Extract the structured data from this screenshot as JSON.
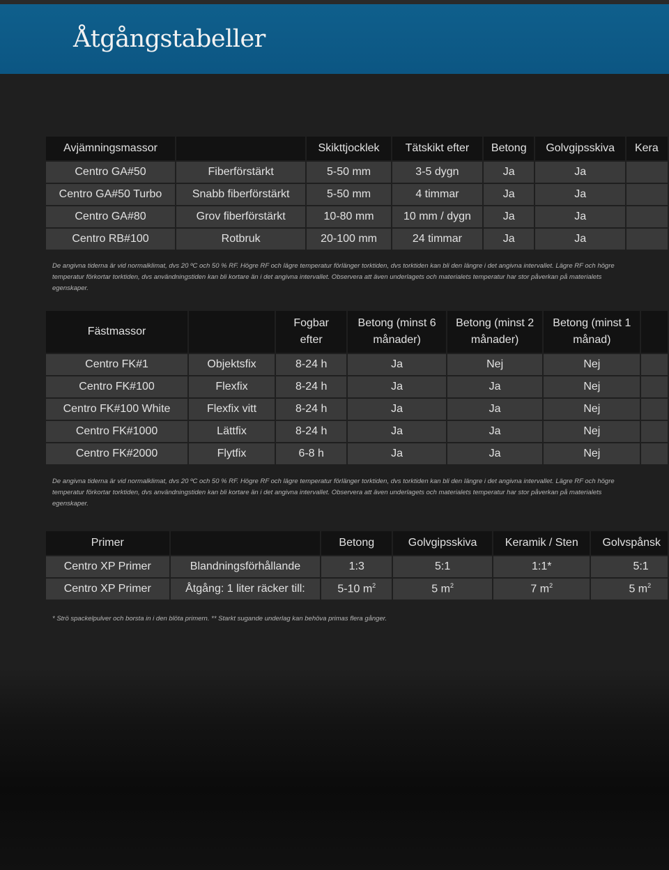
{
  "title": "Åtgångstabeller",
  "table1": {
    "headers": [
      "Avjämningsmassor",
      "",
      "Skikttjocklek",
      "Tätskikt efter",
      "Betong",
      "Golvgipsskiva",
      "Kera"
    ],
    "rows": [
      [
        "Centro GA#50",
        "Fiberförstärkt",
        "5-50 mm",
        "3-5 dygn",
        "Ja",
        "Ja",
        ""
      ],
      [
        "Centro GA#50 Turbo",
        "Snabb fiberförstärkt",
        "5-50 mm",
        "4 timmar",
        "Ja",
        "Ja",
        ""
      ],
      [
        "Centro GA#80",
        "Grov fiberförstärkt",
        "10-80 mm",
        "10 mm / dygn",
        "Ja",
        "Ja",
        ""
      ],
      [
        "Centro RB#100",
        "Rotbruk",
        "20-100 mm",
        "24 timmar",
        "Ja",
        "Ja",
        ""
      ]
    ],
    "note": "De angivna tiderna är vid normalklimat, dvs 20 ºC och 50 % RF. Högre RF och lägre temperatur förlänger torktiden, dvs torktiden kan bli den längre i det angivna intervallet. Lägre RF och högre temperatur förkortar torktiden, dvs användningstiden kan bli kortare än i det angivna intervallet. Observera att även underlagets och materialets temperatur har stor påverkan på materialets egenskaper."
  },
  "table2": {
    "headers": [
      "Fästmassor",
      "",
      "Fogbar efter",
      "Betong (minst 6 månader)",
      "Betong (minst 2 månader)",
      "Betong (minst 1 månad)",
      ""
    ],
    "rows": [
      [
        "Centro FK#1",
        "Objektsfix",
        "8-24 h",
        "Ja",
        "Nej",
        "Nej",
        ""
      ],
      [
        "Centro FK#100",
        "Flexfix",
        "8-24 h",
        "Ja",
        "Ja",
        "Nej",
        ""
      ],
      [
        "Centro FK#100 White",
        "Flexfix vitt",
        "8-24 h",
        "Ja",
        "Ja",
        "Nej",
        ""
      ],
      [
        "Centro FK#1000",
        "Lättfix",
        "8-24 h",
        "Ja",
        "Ja",
        "Nej",
        ""
      ],
      [
        "Centro FK#2000",
        "Flytfix",
        "6-8 h",
        "Ja",
        "Ja",
        "Nej",
        ""
      ]
    ],
    "note": "De angivna tiderna är vid normalklimat, dvs 20 ºC och 50 % RF. Högre RF och lägre temperatur förlänger torktiden, dvs torktiden kan bli den längre i det angivna intervallet. Lägre RF och högre temperatur förkortar torktiden, dvs användningstiden kan bli kortare än i det angivna intervallet. Observera att även underlagets och materialets temperatur har stor påverkan på materialets egenskaper."
  },
  "table3": {
    "headers": [
      "Primer",
      "",
      "Betong",
      "Golvgipsskiva",
      "Keramik / Sten",
      "Golvspånsk"
    ],
    "row1": [
      "Centro XP Primer",
      "Blandningsförhållande",
      "1:3",
      "5:1",
      "1:1*",
      "5:1"
    ],
    "row2": [
      "Centro XP Primer",
      "Åtgång: 1 liter räcker till:",
      "5-10 m",
      "5 m",
      "7 m",
      "5 m"
    ],
    "unit_sup": "2",
    "note": "* Strö spackelpulver och borsta in i den blöta primern. ** Starkt sugande underlag kan behöva primas flera gånger."
  }
}
